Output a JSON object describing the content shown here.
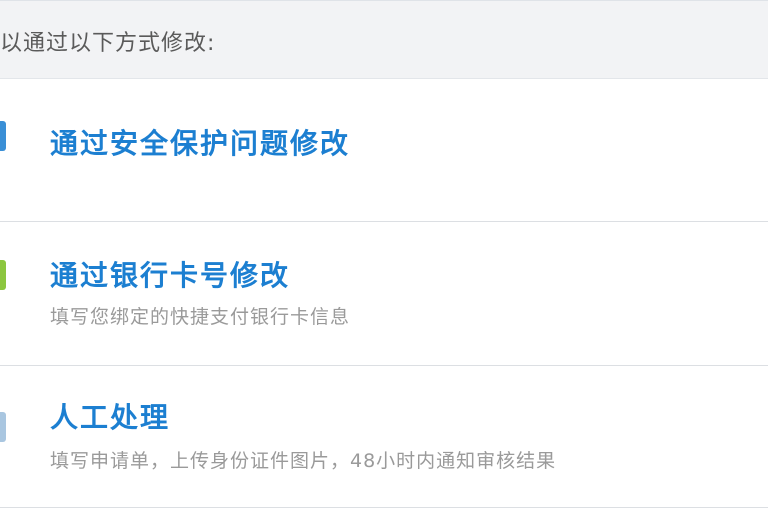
{
  "header": {
    "text": "以通过以下方式修改:"
  },
  "options": [
    {
      "title": "通过安全保护问题修改",
      "description": "",
      "icon": "shield-icon",
      "icon_color": "#3a8fd6"
    },
    {
      "title": "通过银行卡号修改",
      "description": "填写您绑定的快捷支付银行卡信息",
      "icon": "bank-card-icon",
      "icon_color": "#8cc63f"
    },
    {
      "title": "人工处理",
      "description": "填写申请单，上传身份证件图片，48小时内通知审核结果",
      "icon": "manual-service-icon",
      "icon_color": "#a9c6e0"
    }
  ],
  "colors": {
    "title_blue": "#1c7fd1",
    "desc_gray": "#9a9a9a",
    "header_bg": "#f2f3f5"
  }
}
